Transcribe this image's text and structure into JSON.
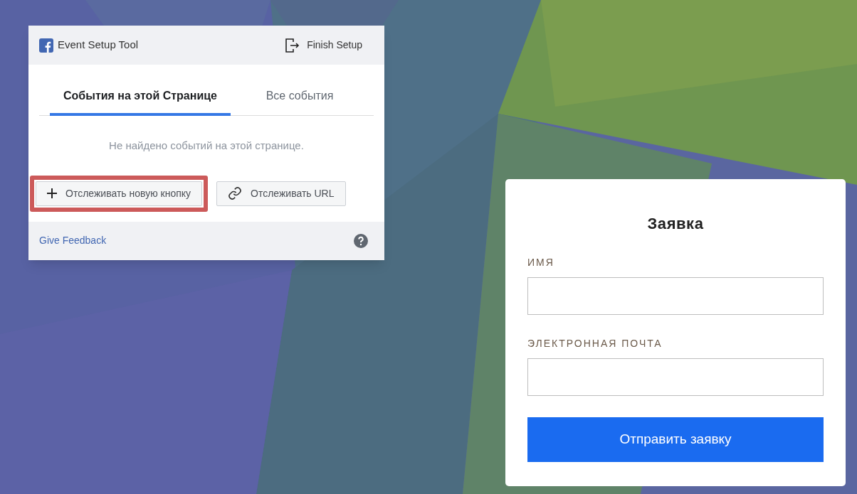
{
  "panel": {
    "title": "Event Setup Tool",
    "finish_button": "Finish Setup",
    "tabs": [
      {
        "label": "События на этой Странице",
        "selected": true
      },
      {
        "label": "Все события",
        "selected": false
      }
    ],
    "empty_message": "Не найдено событий на этой странице.",
    "actions": [
      {
        "kind": "add",
        "label": "Отслеживать новую кнопку",
        "highlighted": true
      },
      {
        "kind": "link",
        "label": "Отслеживать URL",
        "highlighted": false
      }
    ],
    "feedback_link": "Give Feedback"
  },
  "form": {
    "title": "Заявка",
    "fields": [
      {
        "label": "ИМЯ"
      },
      {
        "label": "ЭЛЕКТРОННАЯ ПОЧТА"
      }
    ],
    "submit": "Отправить заявку"
  }
}
